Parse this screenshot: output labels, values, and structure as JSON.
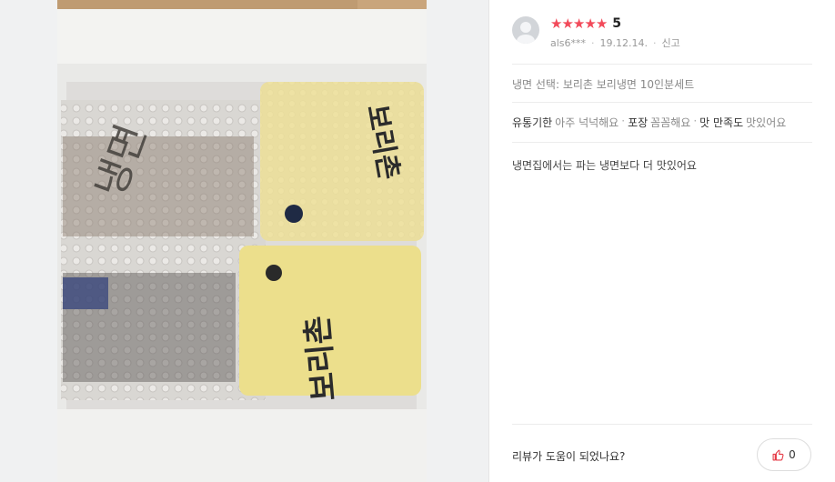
{
  "review": {
    "rating_stars": 5,
    "score": "5",
    "author": "als6***",
    "date": "19.12.14.",
    "report_label": "신고",
    "option": "냉면 선택: 보리촌 보리냉면 10인분세트",
    "tags": [
      {
        "key": "유통기한",
        "value": "아주 넉넉해요"
      },
      {
        "key": "포장",
        "value": "꼼꼼해요"
      },
      {
        "key": "맛 만족도",
        "value": "맛있어요"
      }
    ],
    "body": "냉면집에서는  파는 냉면보다 더 맛있어요"
  },
  "footer": {
    "helpful_question": "리뷰가 도움이 되었나요?",
    "like_count": "0"
  },
  "colors": {
    "star": "#f24a5a",
    "like_icon": "#e53945"
  },
  "photo": {
    "package_text_top": "보리촌",
    "package_text_bottom": "보리촌"
  }
}
